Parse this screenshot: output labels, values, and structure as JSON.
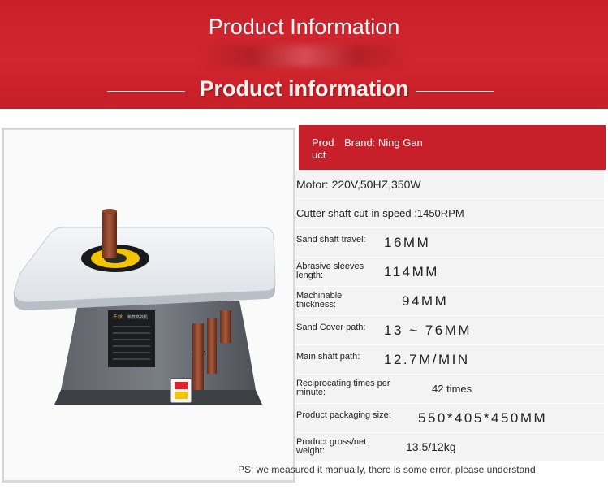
{
  "banner": {
    "title": "Product Information",
    "subtitle": "Product information",
    "color": "#c8202a"
  },
  "image": {
    "plate_label_cn": "千秋",
    "plate_label2_cn": "新款高效机"
  },
  "table": {
    "header_key": "Prod uct",
    "header_value": "Brand: Ning Gan",
    "rows": [
      {
        "key": "Motor: 220V,50HZ,350W",
        "value": ""
      },
      {
        "key": "Cutter shaft cut-in speed :1450RPM",
        "value": ""
      },
      {
        "key": "Sand shaft travel:",
        "value": "16MM"
      },
      {
        "key": "Abrasive sleeves length:",
        "value": "114MM"
      },
      {
        "key": "Machinable thickness:",
        "value": "94MM"
      },
      {
        "key": "Sand Cover path:",
        "value": "13 ~ 76MM"
      },
      {
        "key": "Main shaft path:",
        "value": "12.7M/MIN"
      },
      {
        "key": "Reciprocating times per minute:",
        "value": "42 times"
      },
      {
        "key": "Product packaging size:",
        "value": "550*405*450MM"
      },
      {
        "key": "Product gross/net weight:",
        "value": "13.5/12kg"
      }
    ]
  },
  "note": "PS: we measured it manually, there is some error, please understand"
}
